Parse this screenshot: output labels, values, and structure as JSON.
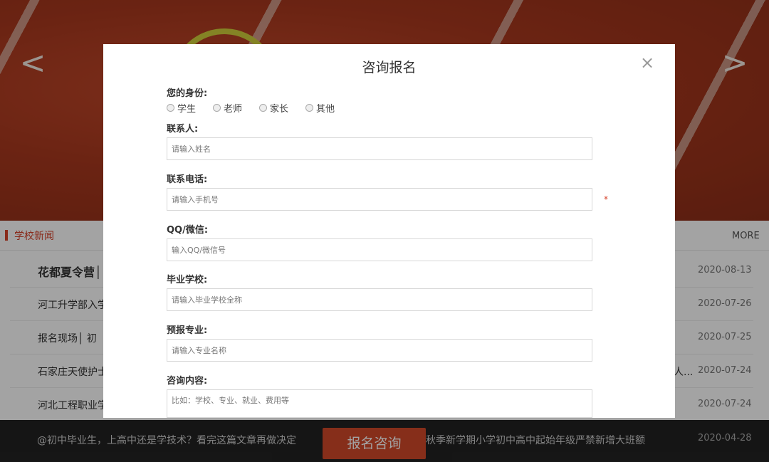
{
  "banner": {
    "prev_icon": "chevron-left-icon",
    "next_icon": "chevron-right-icon",
    "prev_glyph": "<",
    "next_glyph": ">"
  },
  "news": {
    "section_title": "学校新闻",
    "more_label": "MORE",
    "items": [
      {
        "title": "花都夏令营│",
        "date": "2020-08-13"
      },
      {
        "title": "河工升学部入学",
        "date": "2020-07-26"
      },
      {
        "title": "报名现场│ 初",
        "date": "2020-07-25"
      },
      {
        "title": "石家庄天使护士",
        "tail": "人...",
        "date": "2020-07-24"
      },
      {
        "title": "河北工程职业学",
        "date": "2020-07-24"
      }
    ]
  },
  "footer": {
    "ticker_left": "@初中毕业生，上高中还是学技术？看完这篇文章再做决定",
    "ticker_right": "秋季新学期小学初中高中起始年级严禁新增大班额",
    "ticker_date": "2020-04-28",
    "apply_button": "报名咨询"
  },
  "modal": {
    "title": "咨询报名",
    "close_glyph": "×",
    "identity_label": "您的身份:",
    "identity_options": [
      "学生",
      "老师",
      "家长",
      "其他"
    ],
    "contact_label": "联系人:",
    "contact_placeholder": "请输入姓名",
    "phone_label": "联系电话:",
    "phone_placeholder": "请输入手机号",
    "required_mark": "*",
    "qq_label": "QQ/微信:",
    "qq_placeholder": "输入QQ/微信号",
    "school_label": "毕业学校:",
    "school_placeholder": "请输入毕业学校全称",
    "major_label": "预报专业:",
    "major_placeholder": "请输入专业名称",
    "content_label": "咨询内容:",
    "content_placeholder": "比如：学校、专业、就业、费用等"
  },
  "colors": {
    "accent": "#d6422a",
    "button": "#d2482a",
    "footer_bg": "#222222"
  }
}
